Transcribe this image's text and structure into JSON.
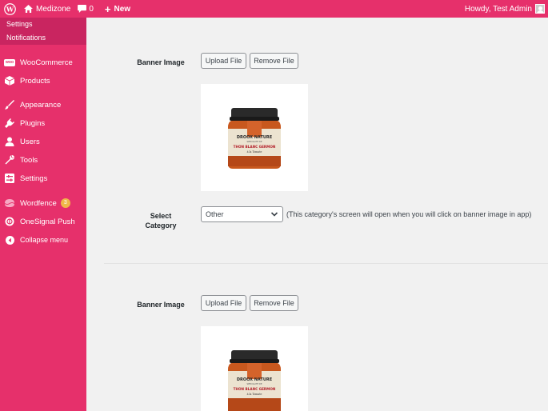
{
  "adminbar": {
    "site_name": "Medizone",
    "comments_count": "0",
    "new_label": "New",
    "howdy": "Howdy, Test Admin"
  },
  "sidebar": {
    "submenu": [
      "Settings",
      "Notifications"
    ],
    "items": [
      {
        "label": "WooCommerce",
        "icon": "woocommerce-icon"
      },
      {
        "label": "Products",
        "icon": "box-icon"
      },
      {
        "label": "Appearance",
        "icon": "paintbrush-icon"
      },
      {
        "label": "Plugins",
        "icon": "plug-icon"
      },
      {
        "label": "Users",
        "icon": "users-icon"
      },
      {
        "label": "Tools",
        "icon": "wrench-icon"
      },
      {
        "label": "Settings",
        "icon": "settings-icon"
      },
      {
        "label": "Wordfence",
        "icon": "wordfence-icon",
        "badge": "3"
      },
      {
        "label": "OneSignal Push",
        "icon": "onesignal-icon"
      },
      {
        "label": "Collapse menu",
        "icon": "collapse-icon"
      }
    ]
  },
  "banners": [
    {
      "label": "Banner Image",
      "upload_label": "Upload File",
      "remove_label": "Remove File"
    },
    {
      "label": "Banner Image",
      "upload_label": "Upload File",
      "remove_label": "Remove File"
    }
  ],
  "category": {
    "label_line1": "Select",
    "label_line2": "Category",
    "selected": "Other",
    "note": "(This category's screen will open when you will click on banner image in app)"
  },
  "product": {
    "brand": "DROOX NATURE",
    "subtitle": "SPECIALITE DE",
    "name": "THON BLANC GERMON",
    "flavor": "à la Tomate"
  },
  "colors": {
    "brand": "#e6306b",
    "submenu_bg": "#c92560",
    "badge": "#f0b849"
  }
}
